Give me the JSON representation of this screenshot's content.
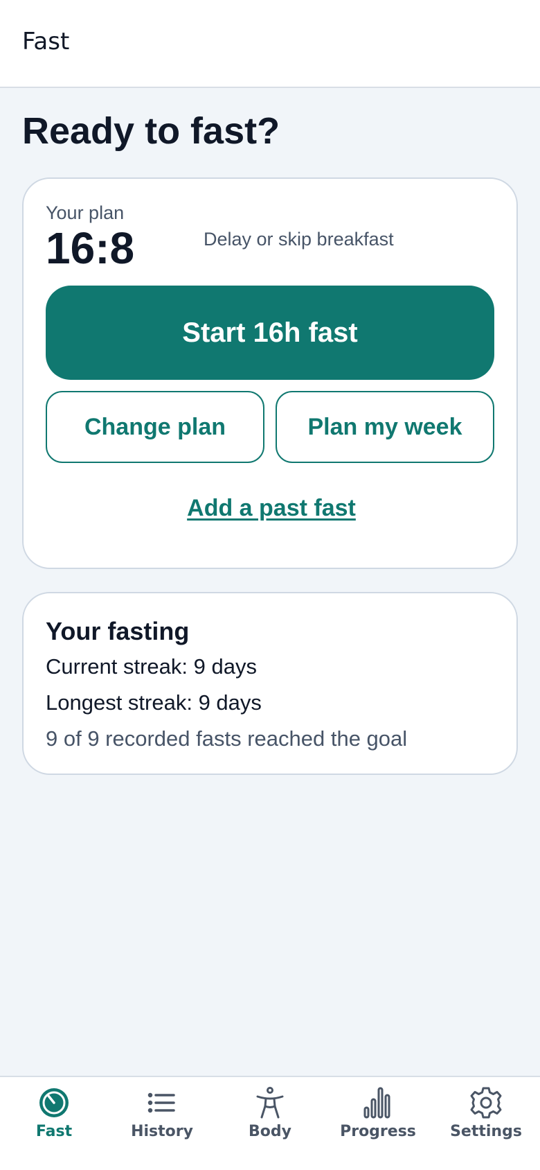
{
  "topbar": {
    "title": "Fast"
  },
  "main": {
    "title": "Ready to fast?"
  },
  "plan_card": {
    "label": "Your plan",
    "value": "16:8",
    "description": "Delay or skip breakfast",
    "start_button": "Start 16h fast",
    "change_plan_button": "Change plan",
    "plan_week_button": "Plan my week",
    "add_past_link": "Add a past fast"
  },
  "stats_card": {
    "title": "Your fasting",
    "current_streak": "Current streak: 9 days",
    "longest_streak": "Longest streak: 9 days",
    "goal_summary": "9 of 9 recorded fasts reached the goal"
  },
  "nav": {
    "items": [
      {
        "label": "Fast",
        "icon": "stopwatch-icon",
        "active": true
      },
      {
        "label": "History",
        "icon": "list-icon",
        "active": false
      },
      {
        "label": "Body",
        "icon": "person-icon",
        "active": false
      },
      {
        "label": "Progress",
        "icon": "bar-chart-icon",
        "active": false
      },
      {
        "label": "Settings",
        "icon": "gear-icon",
        "active": false
      }
    ]
  },
  "colors": {
    "accent": "#107870",
    "background": "#f1f5f9",
    "card": "#ffffff",
    "text_primary": "#101828",
    "text_secondary": "#475467",
    "nav_inactive": "#4a5565"
  }
}
